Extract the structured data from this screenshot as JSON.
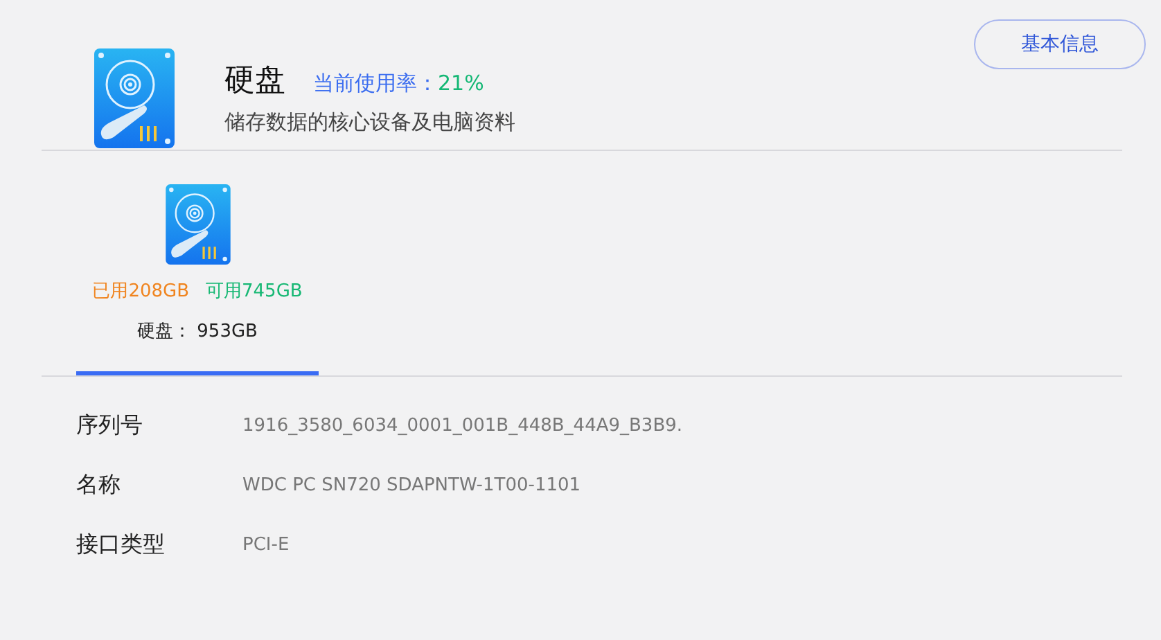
{
  "header": {
    "title": "硬盘",
    "usage_label": "当前使用率：",
    "usage_value": "21%",
    "subtitle": "储存数据的核心设备及电脑资料"
  },
  "info_button": "基本信息",
  "disks": [
    {
      "used": "已用208GB",
      "free": "可用745GB",
      "total": "硬盘： 953GB",
      "selected": true
    }
  ],
  "details": [
    {
      "label": "序列号",
      "value": "1916_3580_6034_0001_001B_448B_44A9_B3B9."
    },
    {
      "label": "名称",
      "value": "WDC PC SN720 SDAPNTW-1T00-1101"
    },
    {
      "label": "接口类型",
      "value": "PCI-E"
    }
  ]
}
